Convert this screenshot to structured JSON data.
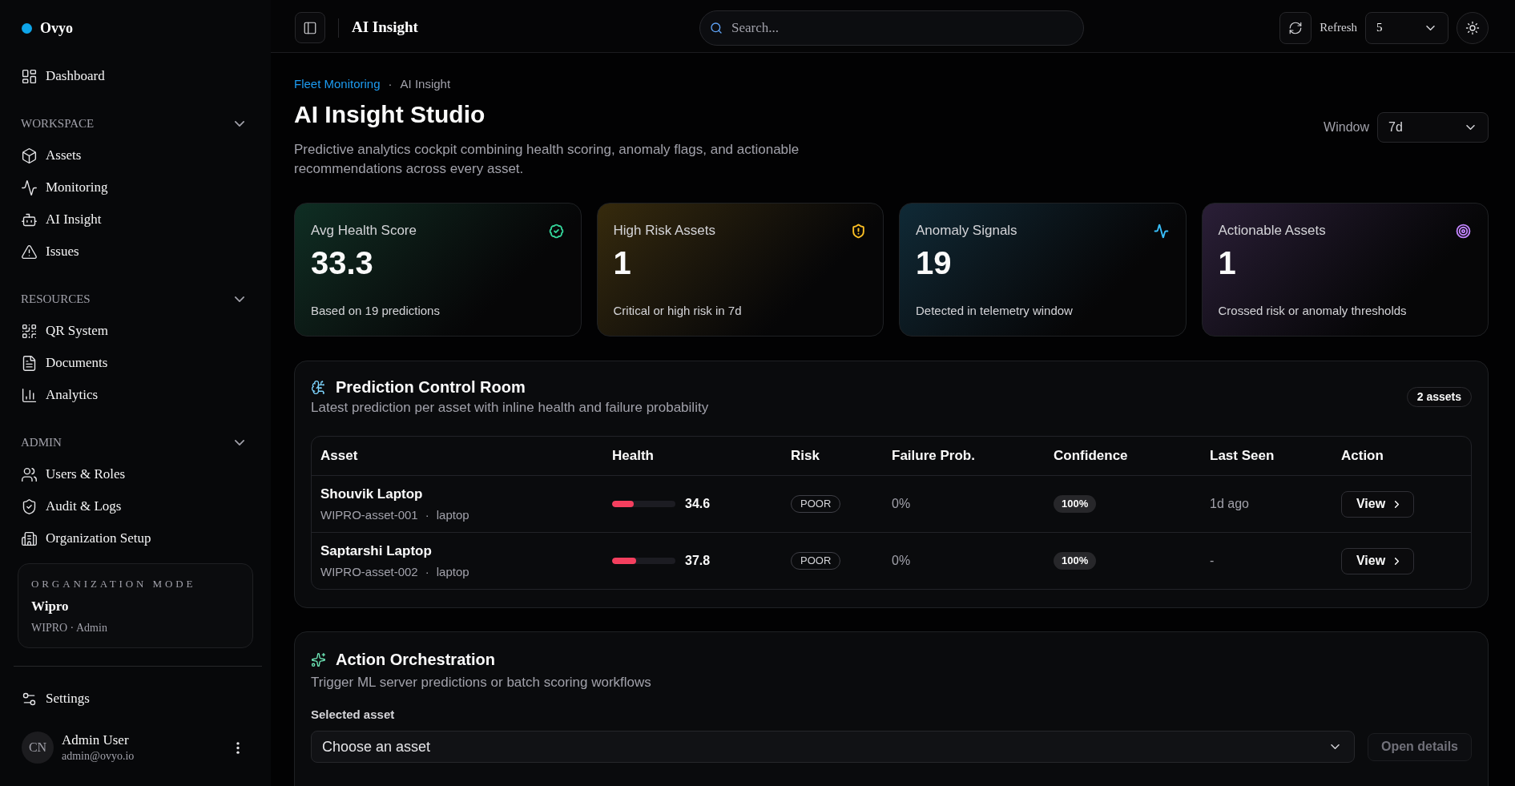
{
  "sidebar": {
    "brand": "Ovyo",
    "nav": [
      {
        "label": "Dashboard"
      }
    ],
    "sections": [
      {
        "title": "WORKSPACE",
        "expanded": true,
        "items": [
          {
            "label": "Assets"
          },
          {
            "label": "Monitoring"
          },
          {
            "label": "AI Insight"
          },
          {
            "label": "Issues"
          }
        ]
      },
      {
        "title": "RESOURCES",
        "expanded": true,
        "items": [
          {
            "label": "QR System"
          },
          {
            "label": "Documents"
          },
          {
            "label": "Analytics"
          }
        ]
      },
      {
        "title": "ADMIN",
        "expanded": true,
        "items": [
          {
            "label": "Users & Roles"
          },
          {
            "label": "Audit & Logs"
          },
          {
            "label": "Organization Setup"
          }
        ]
      }
    ],
    "org_mode": {
      "label": "ORGANIZATION MODE",
      "name": "Wipro",
      "detail": "WIPRO · Admin"
    },
    "footer_items": [
      {
        "label": "Settings"
      }
    ],
    "user": {
      "initials": "CN",
      "name": "Admin User",
      "email": "admin@ovyo.io"
    }
  },
  "header": {
    "title": "AI Insight",
    "search": {
      "placeholder": "Search..."
    },
    "refresh": {
      "label": "Refresh",
      "value": "5"
    }
  },
  "page": {
    "breadcrumb": [
      {
        "label": "Fleet Monitoring",
        "kind": "link"
      },
      {
        "label": "AI Insight",
        "kind": "current"
      }
    ],
    "breadcrumb_separator": "·",
    "title": "AI Insight Studio",
    "description": "Predictive analytics cockpit combining health scoring, anomaly flags, and actionable recommendations across every asset.",
    "window": {
      "label": "Window",
      "value": "7d"
    }
  },
  "stats": [
    {
      "title": "Avg Health Score",
      "value": "33.3",
      "note": "Based on 19 predictions",
      "color": "#34d399"
    },
    {
      "title": "High Risk Assets",
      "value": "1",
      "note": "Critical or high risk in 7d",
      "color": "#fbbf24"
    },
    {
      "title": "Anomaly Signals",
      "value": "19",
      "note": "Detected in telemetry window",
      "color": "#38bdf8"
    },
    {
      "title": "Actionable Assets",
      "value": "1",
      "note": "Crossed risk or anomaly thresholds",
      "color": "#c084fc"
    }
  ],
  "prediction_room": {
    "title": "Prediction Control Room",
    "subtitle": "Latest prediction per asset with inline health and failure probability",
    "badge": "2 assets",
    "columns": [
      "Asset",
      "Health",
      "Risk",
      "Failure Prob.",
      "Confidence",
      "Last Seen",
      "Action"
    ],
    "rows": [
      {
        "asset": "Shouvik Laptop",
        "details": [
          "WIPRO-asset-001",
          "·",
          "laptop"
        ],
        "health": {
          "level": 0.346,
          "reading": "34.6"
        },
        "risk": "POOR",
        "failure_prob": "0%",
        "confidence": "100%",
        "last_seen": "1d ago",
        "action": "View"
      },
      {
        "asset": "Saptarshi Laptop",
        "details": [
          "WIPRO-asset-002",
          "·",
          "laptop"
        ],
        "health": {
          "level": 0.378,
          "reading": "37.8"
        },
        "risk": "POOR",
        "failure_prob": "0%",
        "confidence": "100%",
        "last_seen": "-",
        "action": "View"
      }
    ]
  },
  "action_orchestration": {
    "title": "Action Orchestration",
    "subtitle": "Trigger ML server predictions or batch scoring workflows",
    "field_label": "Selected asset",
    "select": {
      "placeholder": "Choose an asset"
    },
    "button": {
      "label": "Open details",
      "disabled": true
    }
  }
}
